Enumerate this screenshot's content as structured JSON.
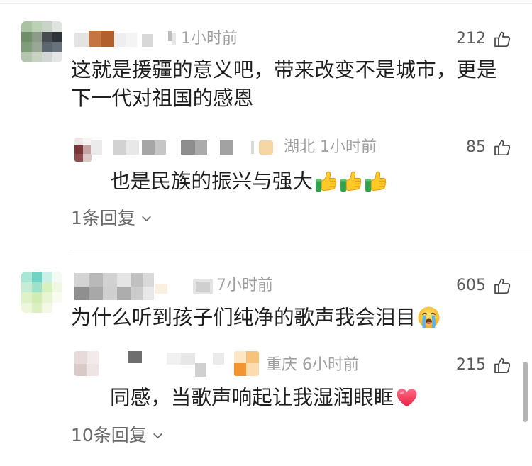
{
  "colors": {
    "background": "#ffffff",
    "text": "#1f1f1f",
    "meta": "#a0a0a0",
    "like_count": "#5a5a5a",
    "toggle": "#6b6b6b",
    "divider": "#ececec",
    "scrollbar": "#b4b4b4"
  },
  "icons": {
    "like": "thumbs-up-outline-icon",
    "expand": "chevron-down-icon"
  },
  "comments": [
    {
      "time": "1小时前",
      "likes": "212",
      "text_lines": [
        "这就是援疆的意义吧，带来改变不是城市，更是",
        "下一代对祖国的感恩"
      ],
      "reply": {
        "location": "湖北",
        "time": "1小时前",
        "likes": "85",
        "text": "也是民族的振兴与强大",
        "emojis": [
          "thumbs-up",
          "thumbs-up",
          "thumbs-up"
        ]
      },
      "more_replies": "1条回复"
    },
    {
      "time": "7小时前",
      "likes": "605",
      "text_lines": [
        "为什么听到孩子们纯净的歌声我会泪目"
      ],
      "emojis": [
        "loudly-crying-face"
      ],
      "reply": {
        "location": "重庆",
        "time": "6小时前",
        "likes": "215",
        "text": "同感，当歌声响起让我湿润眼眶",
        "emojis": [
          "red-heart"
        ]
      },
      "more_replies": "10条回复"
    }
  ]
}
